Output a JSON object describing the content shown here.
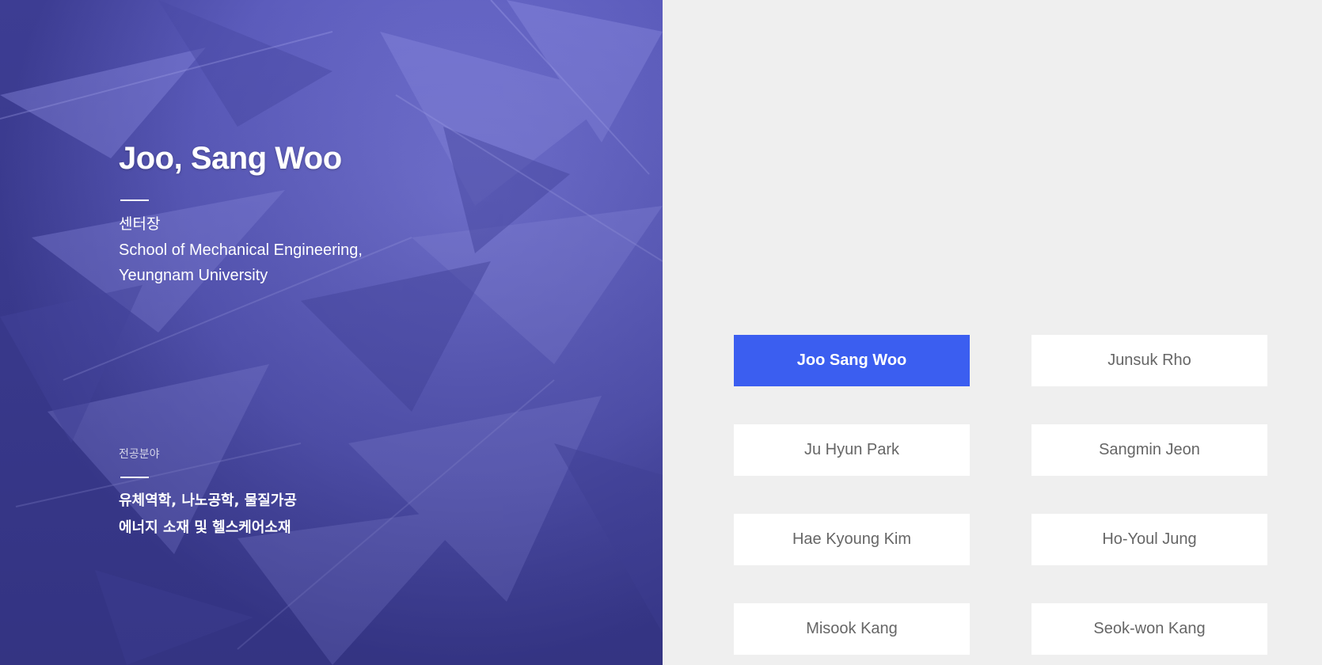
{
  "profile": {
    "name": "Joo, Sang Woo",
    "role": "센터장",
    "affiliation_line1": "School of Mechanical Engineering,",
    "affiliation_line2": "Yeungnam University",
    "field_label": "전공분야",
    "field_line1": "유체역학, 나노공학, 물질가공",
    "field_line2": "에너지 소재 및 헬스케어소재"
  },
  "members": [
    {
      "label": "Joo Sang Woo",
      "selected": true
    },
    {
      "label": "Junsuk Rho",
      "selected": false
    },
    {
      "label": "Ju Hyun Park",
      "selected": false
    },
    {
      "label": "Sangmin Jeon",
      "selected": false
    },
    {
      "label": "Hae Kyoung Kim",
      "selected": false
    },
    {
      "label": "Ho-Youl Jung",
      "selected": false
    },
    {
      "label": "Misook Kang",
      "selected": false
    },
    {
      "label": "Seok-won Kang",
      "selected": false
    }
  ],
  "colors": {
    "hero_tint": "#5f5fc0",
    "accent": "#3b5ef0",
    "background": "#efefef"
  }
}
